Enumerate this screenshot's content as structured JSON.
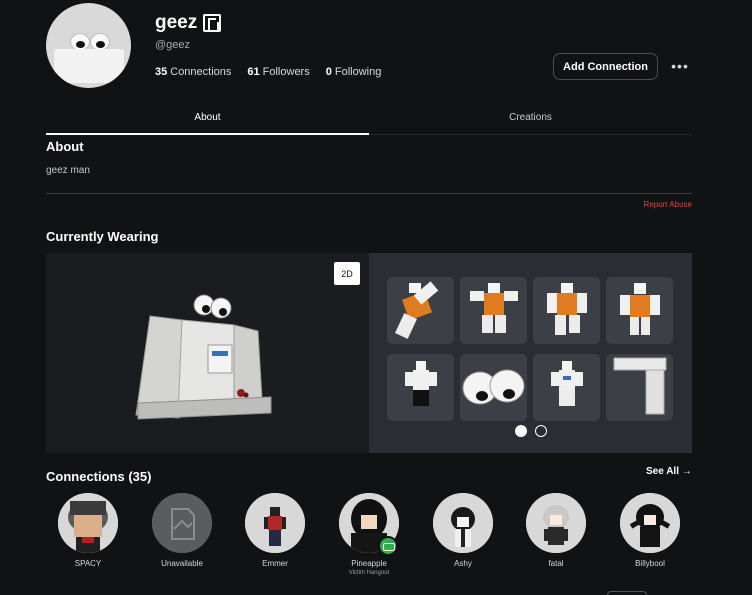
{
  "profile": {
    "display_name": "geez",
    "handle": "@geez",
    "stats": [
      {
        "count": "35",
        "label": "Connections"
      },
      {
        "count": "61",
        "label": "Followers"
      },
      {
        "count": "0",
        "label": "Following"
      }
    ],
    "add_connection_label": "Add Connection",
    "more_label": "•••"
  },
  "tabs": [
    {
      "label": "About"
    },
    {
      "label": "Creations"
    }
  ],
  "about": {
    "title": "About",
    "bio": "geez man",
    "report_label": "Report Abuse"
  },
  "wearing": {
    "title": "Currently Wearing",
    "toggle_label": "2D",
    "page_count": 2,
    "current_page": 1
  },
  "connections": {
    "title": "Connections (35)",
    "see_all": "See All →",
    "items": [
      {
        "name": "SPACY",
        "sub": ""
      },
      {
        "name": "Unavailable",
        "sub": ""
      },
      {
        "name": "Emmer",
        "sub": ""
      },
      {
        "name": "Pineapple",
        "sub": "Victim Hangout"
      },
      {
        "name": "Ashy",
        "sub": ""
      },
      {
        "name": "fatal",
        "sub": ""
      },
      {
        "name": "Billybool",
        "sub": ""
      }
    ]
  },
  "colors": {
    "background": "#111214",
    "report": "#e34444",
    "online_badge": "#2fb14a"
  }
}
